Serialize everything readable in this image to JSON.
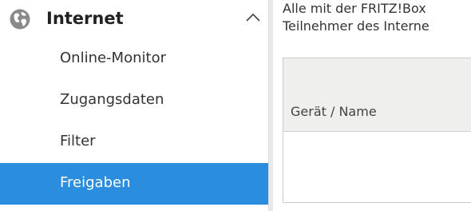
{
  "sidebar": {
    "section": {
      "label": "Internet",
      "icon": "globe-icon",
      "toggle_icon": "chevron-up-icon",
      "expanded": true
    },
    "items": [
      {
        "label": "Online-Monitor",
        "active": false
      },
      {
        "label": "Zugangsdaten",
        "active": false
      },
      {
        "label": "Filter",
        "active": false
      },
      {
        "label": "Freigaben",
        "active": true
      }
    ]
  },
  "main": {
    "intro_lines": [
      "Alle mit der FRITZ!Box",
      "Teilnehmer des Interne"
    ],
    "table": {
      "columns": [
        "Gerät / Name"
      ]
    }
  },
  "colors": {
    "active_bg": "#2b8ddd",
    "active_text": "#ffffff",
    "table_header_bg": "#efefed",
    "globe_icon": "#8a8a8a"
  }
}
